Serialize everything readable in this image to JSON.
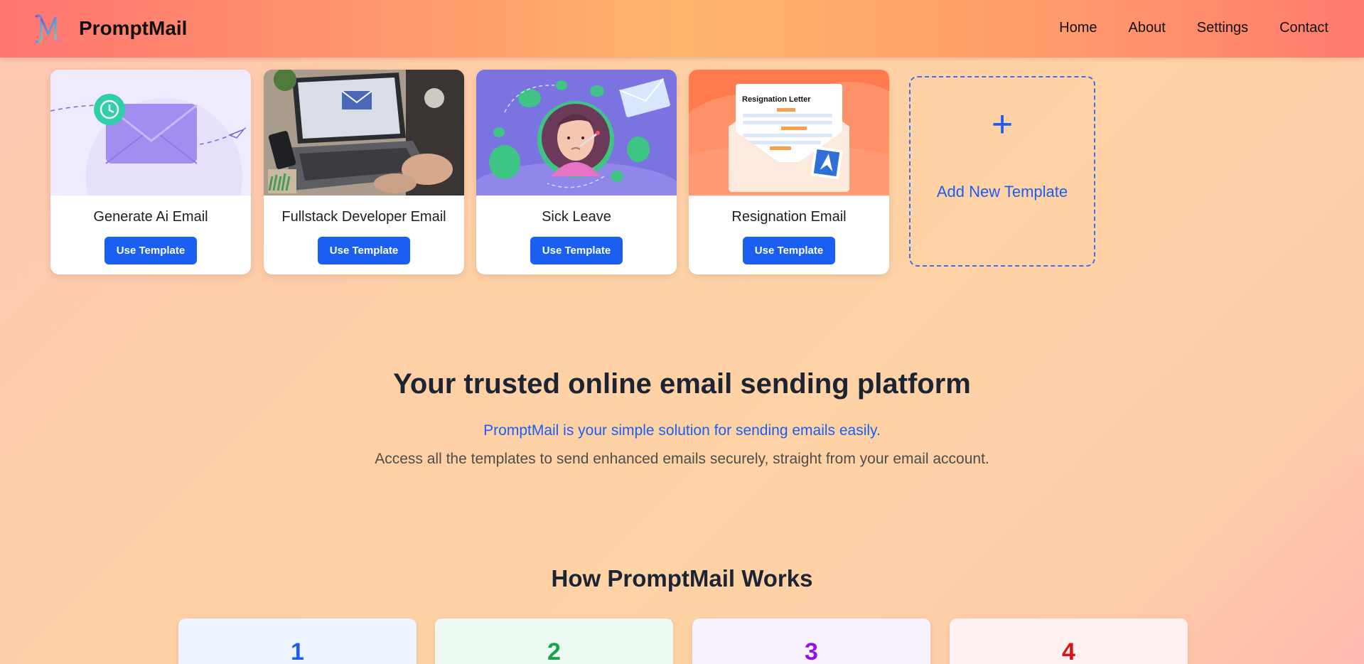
{
  "header": {
    "brand": "PromptMail",
    "nav": [
      "Home",
      "About",
      "Settings",
      "Contact"
    ]
  },
  "templates": [
    {
      "title": "Generate Ai Email",
      "button": "Use Template",
      "image": "envelope-clock-illustration"
    },
    {
      "title": "Fullstack Developer Email",
      "button": "Use Template",
      "image": "laptop-email-photo"
    },
    {
      "title": "Sick Leave",
      "button": "Use Template",
      "image": "sick-person-illustration"
    },
    {
      "title": "Resignation Email",
      "button": "Use Template",
      "image": "resignation-letter-illustration",
      "image_text": "Resignation Letter"
    }
  ],
  "add_template": {
    "icon": "+",
    "label": "Add New Template"
  },
  "hero": {
    "title": "Your trusted online email sending platform",
    "subtitle": "PromptMail is your simple solution for sending emails easily.",
    "description": "Access all the templates to send enhanced emails securely, straight from your email account."
  },
  "how": {
    "title": "How PromptMail Works",
    "steps": [
      {
        "number": "1",
        "color": "#1a5ef2",
        "bg": "#eef4ff"
      },
      {
        "number": "2",
        "color": "#17a34a",
        "bg": "#ecfaf2"
      },
      {
        "number": "3",
        "color": "#9313e6",
        "bg": "#f8f2ff"
      },
      {
        "number": "4",
        "color": "#dc1111",
        "bg": "#fff1f1"
      }
    ]
  },
  "colors": {
    "accent": "#1a5ef2",
    "heading": "#1c2433"
  }
}
